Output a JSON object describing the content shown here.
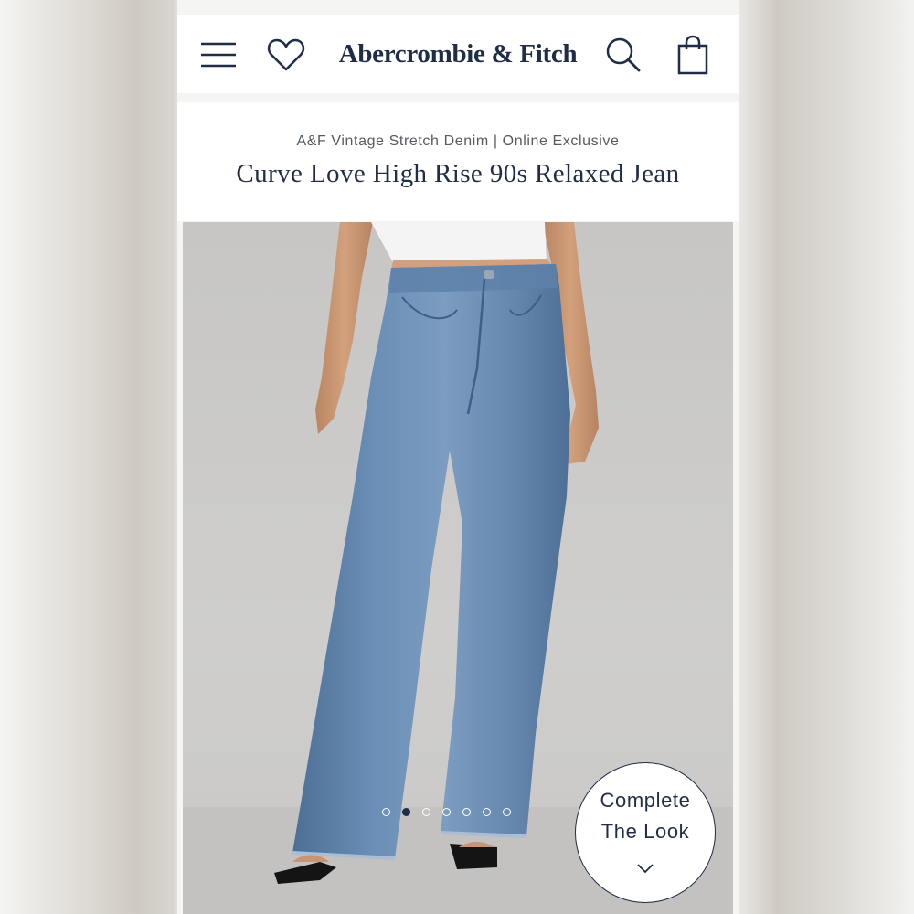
{
  "brand": "Abercrombie & Fitch",
  "header": {
    "menu_icon": "hamburger-menu-icon",
    "wishlist_icon": "heart-icon",
    "search_icon": "search-icon",
    "bag_icon": "shopping-bag-icon"
  },
  "product": {
    "collection": "A&F Vintage Stretch Denim | Online Exclusive",
    "name": "Curve Love High Rise 90s Relaxed Jean"
  },
  "carousel": {
    "count": 7,
    "active_index": 1
  },
  "complete_the_look": {
    "line1": "Complete",
    "line2": "The Look",
    "icon": "chevron-down-icon"
  },
  "colors": {
    "brand_navy": "#1f2d46",
    "denim": "#5a7fa8"
  }
}
